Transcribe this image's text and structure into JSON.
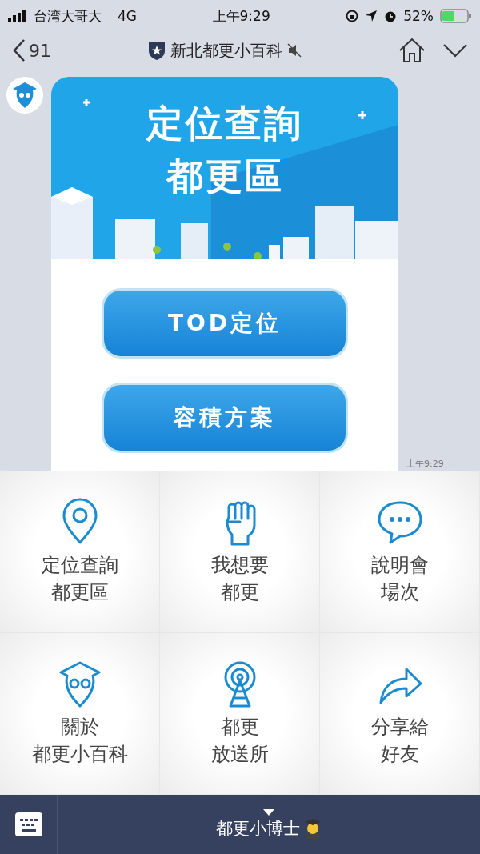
{
  "status_bar": {
    "carrier": "台湾大哥大",
    "network": "4G",
    "time": "上午9:29",
    "battery": "52%"
  },
  "header": {
    "back_count": "91",
    "title": "新北都更小百科"
  },
  "message": {
    "banner_lines": [
      "定位查詢",
      "都更區"
    ],
    "buttons": [
      "TOD定位",
      "容積方案"
    ],
    "time": "上午9:29"
  },
  "menu": [
    {
      "kind": "pin",
      "lines": [
        "定位查詢",
        "都更區"
      ]
    },
    {
      "kind": "fist",
      "lines": [
        "我想要",
        "都更"
      ]
    },
    {
      "kind": "chat",
      "lines": [
        "說明會",
        "場次"
      ]
    },
    {
      "kind": "owl",
      "lines": [
        "關於",
        "都更小百科"
      ]
    },
    {
      "kind": "tower",
      "lines": [
        "都更",
        "放送所"
      ]
    },
    {
      "kind": "share",
      "lines": [
        "分享給",
        "好友"
      ]
    }
  ],
  "bottom_bar": {
    "label": "都更小博士"
  }
}
